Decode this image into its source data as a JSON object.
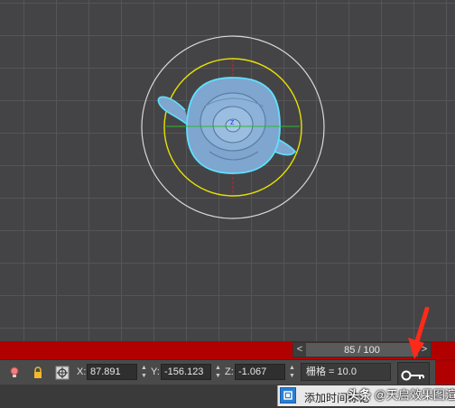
{
  "viewport": {
    "axis_z_label": "z"
  },
  "time_slider": {
    "prev": "<",
    "next": ">",
    "frame_text": "85 / 100"
  },
  "status_bar": {
    "x_label": "X:",
    "x_value": "87.891",
    "y_label": "Y:",
    "y_value": "-156.123",
    "z_label": "Z:",
    "z_value": "-1.067",
    "grid_text": "栅格 = 10.0"
  },
  "bottom_bar": {
    "add_time_tag": "添加时间标记"
  },
  "watermark": {
    "brand": "头条",
    "handle": "@天启效果图渲"
  },
  "colors": {
    "timebar_red": "#b00000",
    "selection_yellow": "#e8e000",
    "teapot_blue": "#7ea6cf",
    "outline_cyan": "#5fe0ff",
    "annotation_red": "#ff2a1a"
  },
  "icons": {
    "lightbulb": "lightbulb-icon",
    "lock": "lock-icon",
    "transform": "transform-mode-icon",
    "key": "key-icon",
    "time_tag": "time-tag-icon"
  }
}
